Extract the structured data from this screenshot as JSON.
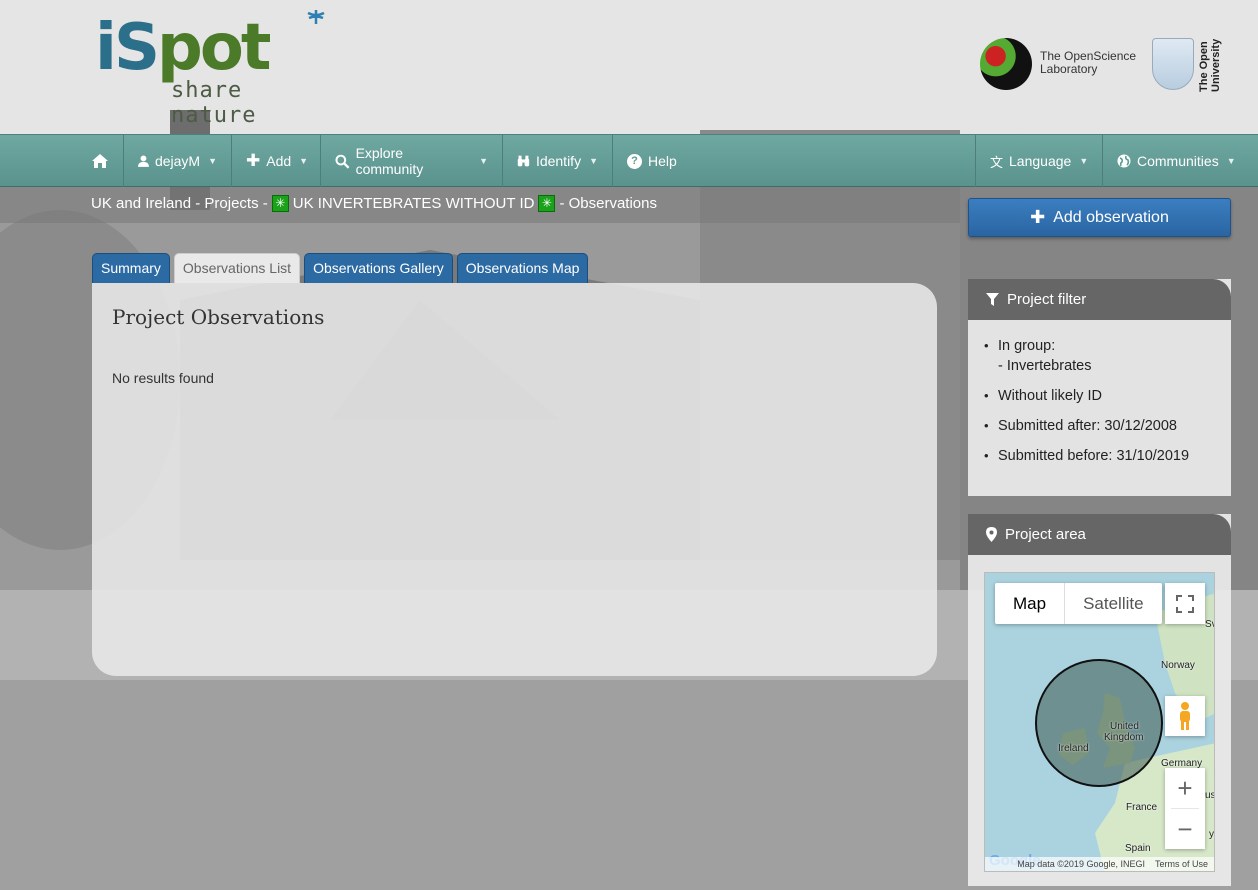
{
  "header": {
    "logo_main_i": "iS",
    "logo_main_pot": "pot",
    "logo_sub": "share nature",
    "osl_line1": "The OpenScience",
    "osl_line2": "Laboratory",
    "ou_line1": "The Open",
    "ou_line2": "University"
  },
  "nav": {
    "home_icon": "home-icon",
    "user": "dejayM",
    "add": "Add",
    "explore": "Explore community",
    "identify": "Identify",
    "help": "Help",
    "language": "Language",
    "communities": "Communities"
  },
  "breadcrumb": {
    "part1": "UK and Ireland - Projects -",
    "project": "UK INVERTEBRATES WITHOUT ID",
    "part3": "- Observations",
    "badge": "✳"
  },
  "tabs": [
    {
      "label": "Summary"
    },
    {
      "label": "Observations List"
    },
    {
      "label": "Observations Gallery"
    },
    {
      "label": "Observations Map"
    }
  ],
  "main": {
    "title": "Project Observations",
    "no_results": "No results found"
  },
  "sidebar": {
    "add_observation": "Add observation",
    "filter_title": "Project filter",
    "filters": [
      {
        "line1": "In group:",
        "line2": "- Invertebrates"
      },
      {
        "line1": "Without likely ID",
        "line2": ""
      },
      {
        "line1": "Submitted after: 30/12/2008",
        "line2": ""
      },
      {
        "line1": "Submitted before: 31/10/2019",
        "line2": ""
      }
    ],
    "area_title": "Project area"
  },
  "map": {
    "type_map": "Map",
    "type_satellite": "Satellite",
    "labels": {
      "norway": "Norway",
      "uk1": "United",
      "uk2": "Kingdom",
      "ireland": "Ireland",
      "germany": "Germany",
      "france": "France",
      "spain": "Spain",
      "sv": "Sv",
      "ust": "ust",
      "y": "y"
    },
    "footer_data": "Map data ©2019 Google, INEGI",
    "footer_terms": "Terms of Use",
    "google": "Google"
  },
  "colors": {
    "nav": "#5f9a94",
    "tab": "#2c6aa3",
    "button": "#2f6faf",
    "panel_head": "#666666"
  }
}
